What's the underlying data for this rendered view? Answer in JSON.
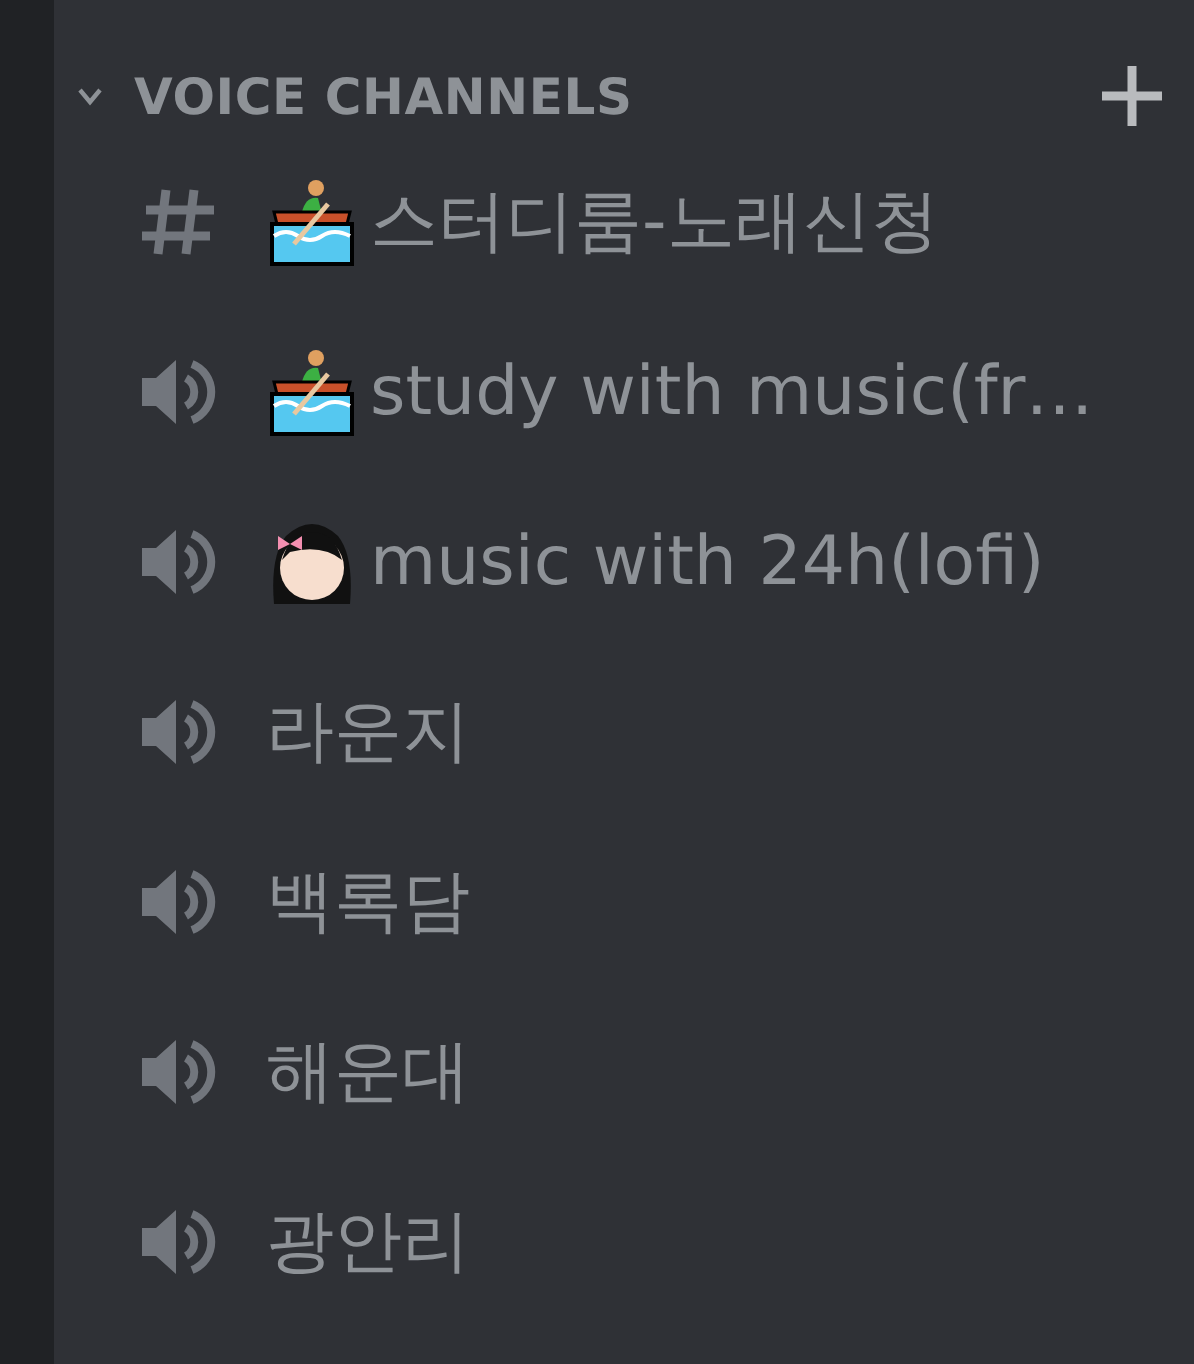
{
  "category": {
    "title": "VOICE CHANNELS",
    "expanded": true
  },
  "channels": [
    {
      "kind": "text",
      "name": "스터디룸-노래신청"
    },
    {
      "kind": "voice",
      "name": "study with music(fr…"
    },
    {
      "kind": "voice",
      "name": "music with 24h(lofi)"
    },
    {
      "kind": "voice",
      "name": "라운지"
    },
    {
      "kind": "voice",
      "name": "백록담"
    },
    {
      "kind": "voice",
      "name": "해운대"
    },
    {
      "kind": "voice",
      "name": "광안리"
    }
  ]
}
